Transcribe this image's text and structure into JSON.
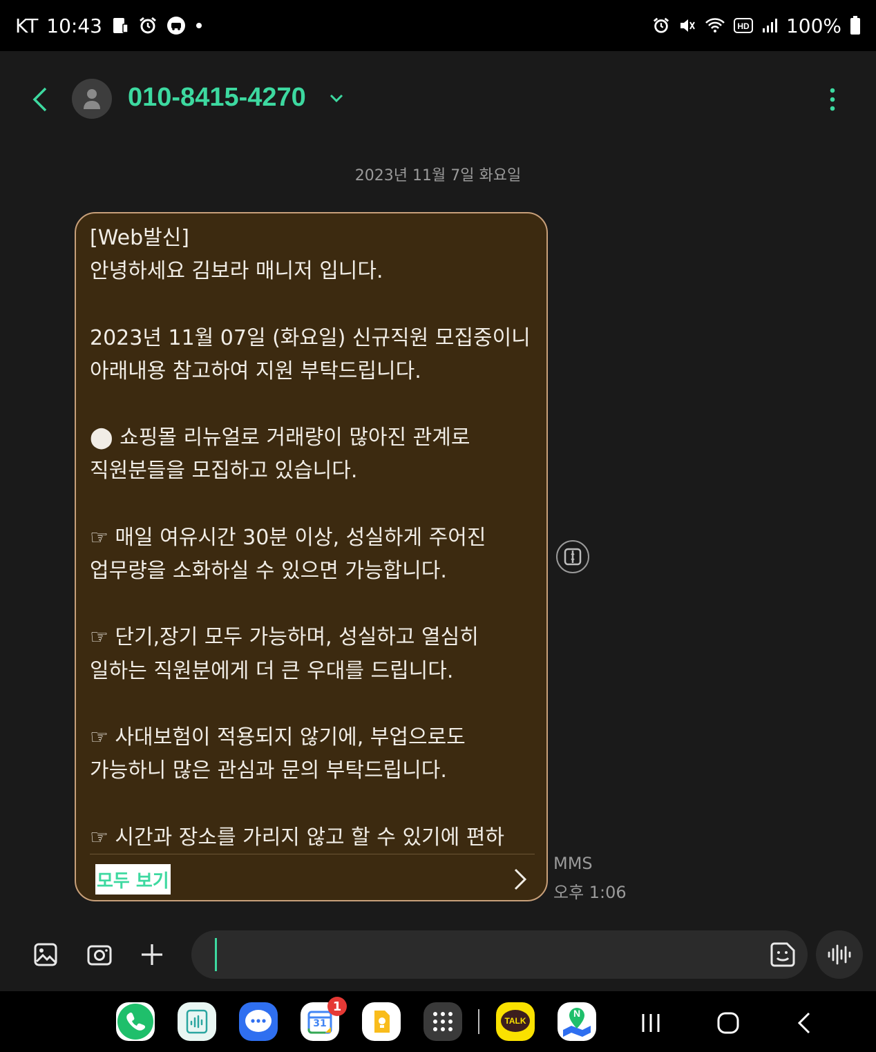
{
  "status_bar": {
    "carrier": "KT",
    "time": "10:43",
    "battery": "100%"
  },
  "header": {
    "contact": "010-8415-4270"
  },
  "conversation": {
    "date": "2023년 11월 7일 화요일"
  },
  "message": {
    "text": "[Web발신]\n안녕하세요 김보라 매니저 입니다.\n\n2023년 11월 07일 (화요일) 신규직원 모집중이니\n아래내용 참고하여 지원 부탁드립니다.\n\n⬤ 쇼핑몰 리뉴얼로 거래량이 많아진 관계로\n직원분들을 모집하고 있습니다.\n\n☞ 매일 여유시간 30분 이상, 성실하게 주어진\n업무량을 소화하실 수 있으면 가능합니다.\n\n☞ 단기,장기 모두 가능하며, 성실하고 열심히\n일하는 직원분에게 더 큰 우대를 드립니다.\n\n☞ 사대보험이 적용되지 않기에, 부업으로도\n가능하니 많은 관심과 문의 부탁드립니다.\n\n☞ 시간과 장소를 가리지 않고 할 수 있기에 편하",
    "view_all_label": "모두 보기",
    "type": "MMS",
    "time": "오후 1:06"
  },
  "dock": {
    "calendar_day": "31",
    "calendar_badge": "1",
    "talk_label": "TALK",
    "naver_label": "N"
  },
  "colors": {
    "accent": "#3dd9a0",
    "bubble_bg": "#3c2a10",
    "bubble_border": "#c8a07a",
    "background": "#1a1a1a"
  }
}
